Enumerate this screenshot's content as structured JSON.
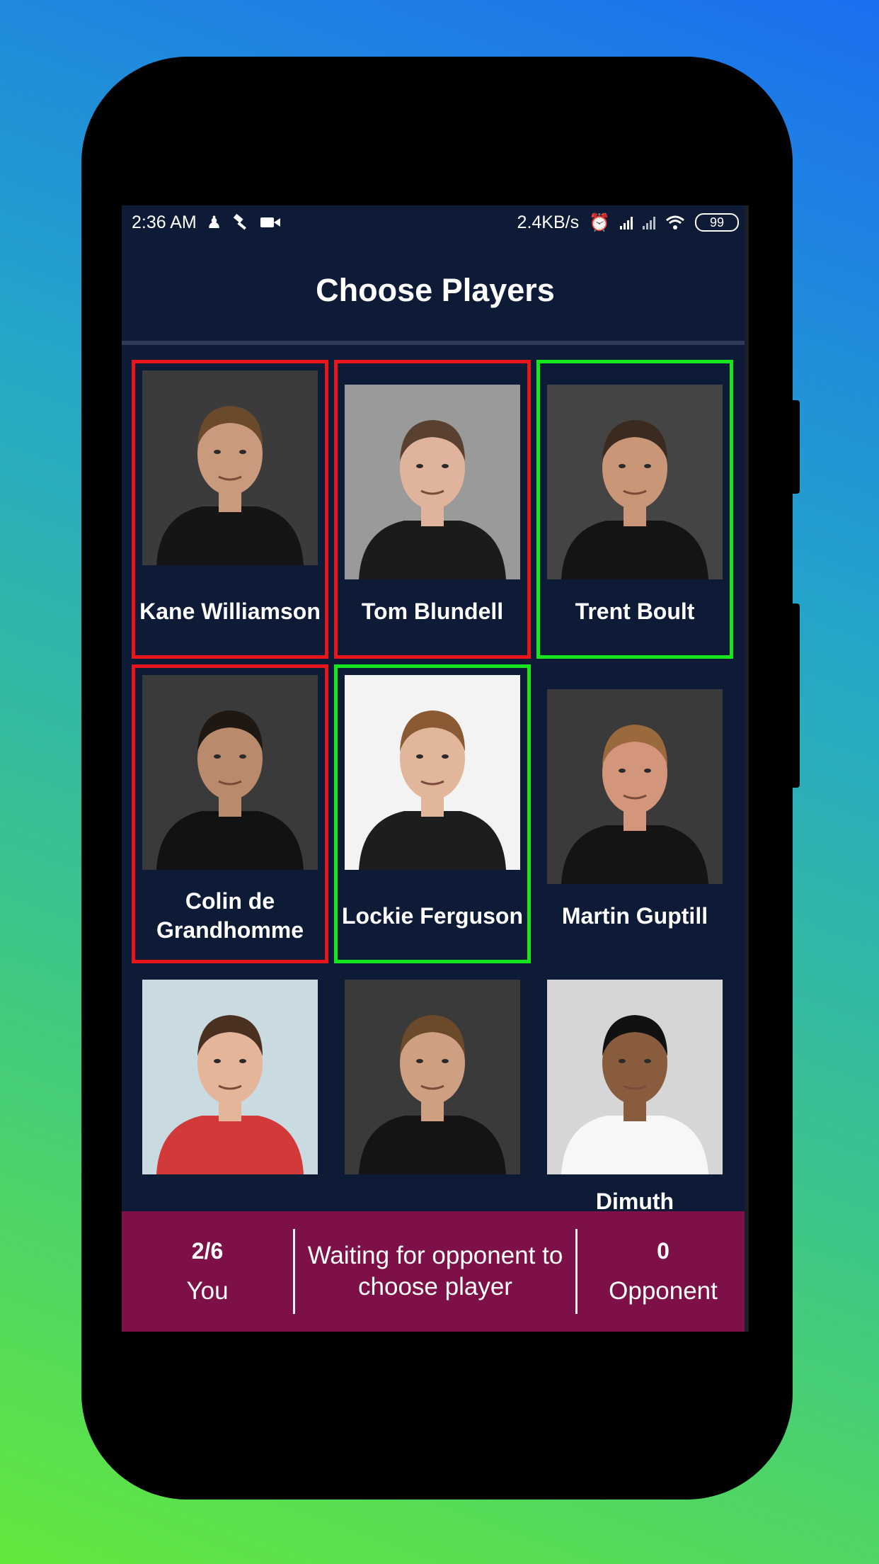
{
  "status_bar": {
    "time": "2:36 AM",
    "network_speed": "2.4KB/s",
    "battery": "99",
    "left_icons": [
      "chess-piece-icon",
      "auction-hammer-icon",
      "video-camera-icon"
    ],
    "right_icons": [
      "alarm-clock-icon",
      "signal-icon",
      "signal-icon",
      "wifi-icon",
      "battery-icon"
    ]
  },
  "header": {
    "title": "Choose Players"
  },
  "players": [
    {
      "name": "Kane Williamson",
      "state": "red",
      "bg": "#3b3b3b",
      "skin": "#c99a7c",
      "hair": "#6b4a2c",
      "shirt": "#151515"
    },
    {
      "name": "Tom Blundell",
      "state": "red",
      "bg": "#9a9a9a",
      "skin": "#e0b49c",
      "hair": "#5a4030",
      "shirt": "#1b1b1b"
    },
    {
      "name": "Trent Boult",
      "state": "green",
      "bg": "#444444",
      "skin": "#c99678",
      "hair": "#3a2a20",
      "shirt": "#141414"
    },
    {
      "name": "Colin de Grandhomme",
      "state": "red",
      "bg": "#3a3a3a",
      "skin": "#b98a6c",
      "hair": "#1e1712",
      "shirt": "#121212"
    },
    {
      "name": "Lockie Ferguson",
      "state": "green",
      "bg": "#f3f3f3",
      "skin": "#e2b69a",
      "hair": "#8a5a35",
      "shirt": "#1d1d1d"
    },
    {
      "name": "Martin Guptill",
      "state": "none",
      "bg": "#3a3a3a",
      "skin": "#d4967a",
      "hair": "#9a6a3e",
      "shirt": "#141414"
    },
    {
      "name": "",
      "state": "none",
      "bg": "#c9dbe0",
      "skin": "#e5b59a",
      "hair": "#4a3020",
      "shirt": "#d23a3a"
    },
    {
      "name": "",
      "state": "none",
      "bg": "#3a3a3a",
      "skin": "#cf9f82",
      "hair": "#6b4a2c",
      "shirt": "#141414"
    },
    {
      "name": "Dimuth",
      "state": "none",
      "bg": "#d6d6d6",
      "skin": "#8a5c3e",
      "hair": "#111111",
      "shirt": "#f7f7f7"
    }
  ],
  "footer": {
    "you_score": "2/6",
    "you_label": "You",
    "message": "Waiting for opponent to choose player",
    "opponent_score": "0",
    "opponent_label": "Opponent"
  },
  "colors": {
    "selected_red": "#e8161b",
    "selected_green": "#16e61d",
    "footer_bg": "#7d1147",
    "screen_bg": "#0e1b36"
  }
}
